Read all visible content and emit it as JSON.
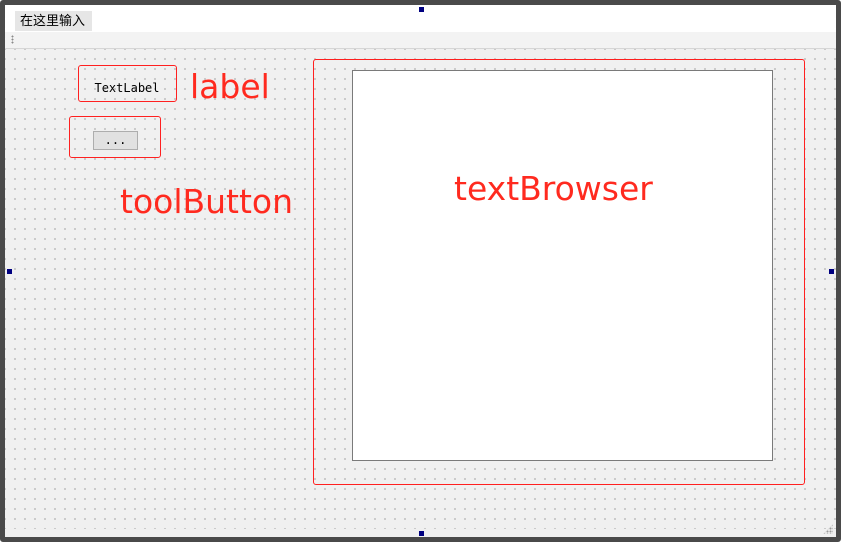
{
  "menubar": {
    "input_placeholder": "在这里输入"
  },
  "widgets": {
    "label_text": "TextLabel",
    "toolbutton_text": "..."
  },
  "annotations": {
    "label": "label",
    "toolbutton": "toolButton",
    "textbrowser": "textBrowser"
  },
  "colors": {
    "annotation": "#ff2a1f",
    "selection_handle": "#000080",
    "canvas_background": "#f0f0f0"
  },
  "icons": {
    "toolbar_grip": "grip-dots-icon",
    "size_grip": "resize-grip-icon"
  }
}
